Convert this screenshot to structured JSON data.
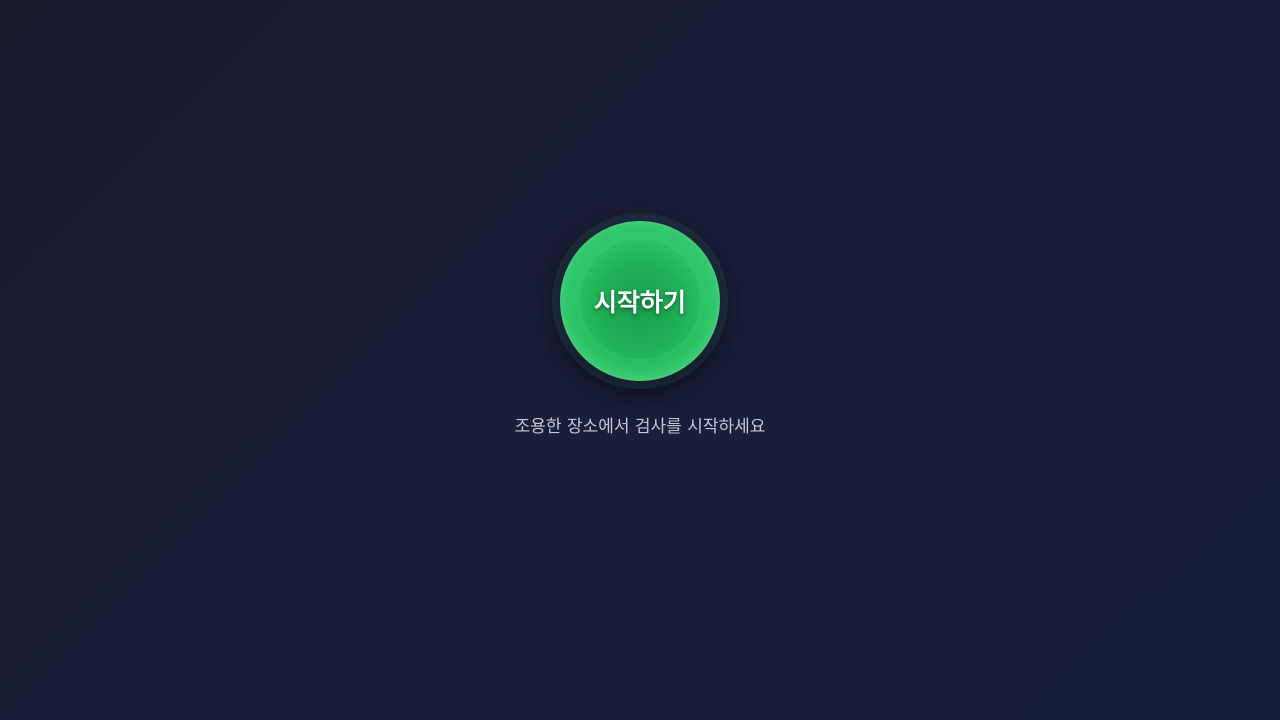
{
  "start": {
    "button_label": "시작하기"
  },
  "hint": {
    "text": "조용한 장소에서 검사를 시작하세요"
  },
  "colors": {
    "background": "#1b1d36",
    "button_green": "#2cc467",
    "hint_text": "#c5c8d4"
  }
}
